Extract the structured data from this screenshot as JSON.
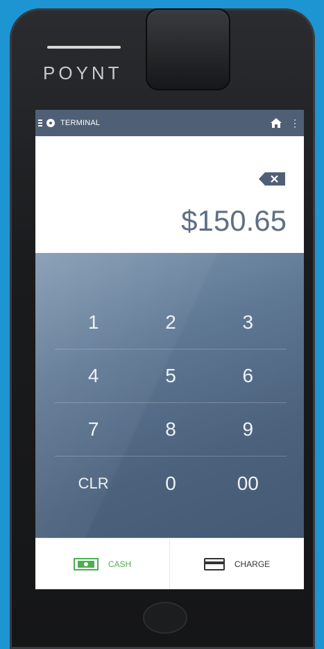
{
  "device": {
    "brand": "POYNT"
  },
  "status_bar": {
    "title": "TERMINAL",
    "more_glyph": "⋮"
  },
  "amount": {
    "value": "$150.65"
  },
  "keypad": {
    "rows": [
      [
        "1",
        "2",
        "3"
      ],
      [
        "4",
        "5",
        "6"
      ],
      [
        "7",
        "8",
        "9"
      ],
      [
        "CLR",
        "0",
        "00"
      ]
    ]
  },
  "actions": {
    "cash_label": "CASH",
    "charge_label": "CHARGE"
  },
  "colors": {
    "background": "#1d95d3",
    "status_bar": "#4f6076",
    "keypad": "#5e7793",
    "cash_green": "#4caf50",
    "amount_text": "#5f6f84"
  },
  "icons": [
    "menu-icon",
    "gear-icon",
    "home-icon",
    "more-icon",
    "backspace-icon",
    "cash-icon",
    "card-icon"
  ]
}
